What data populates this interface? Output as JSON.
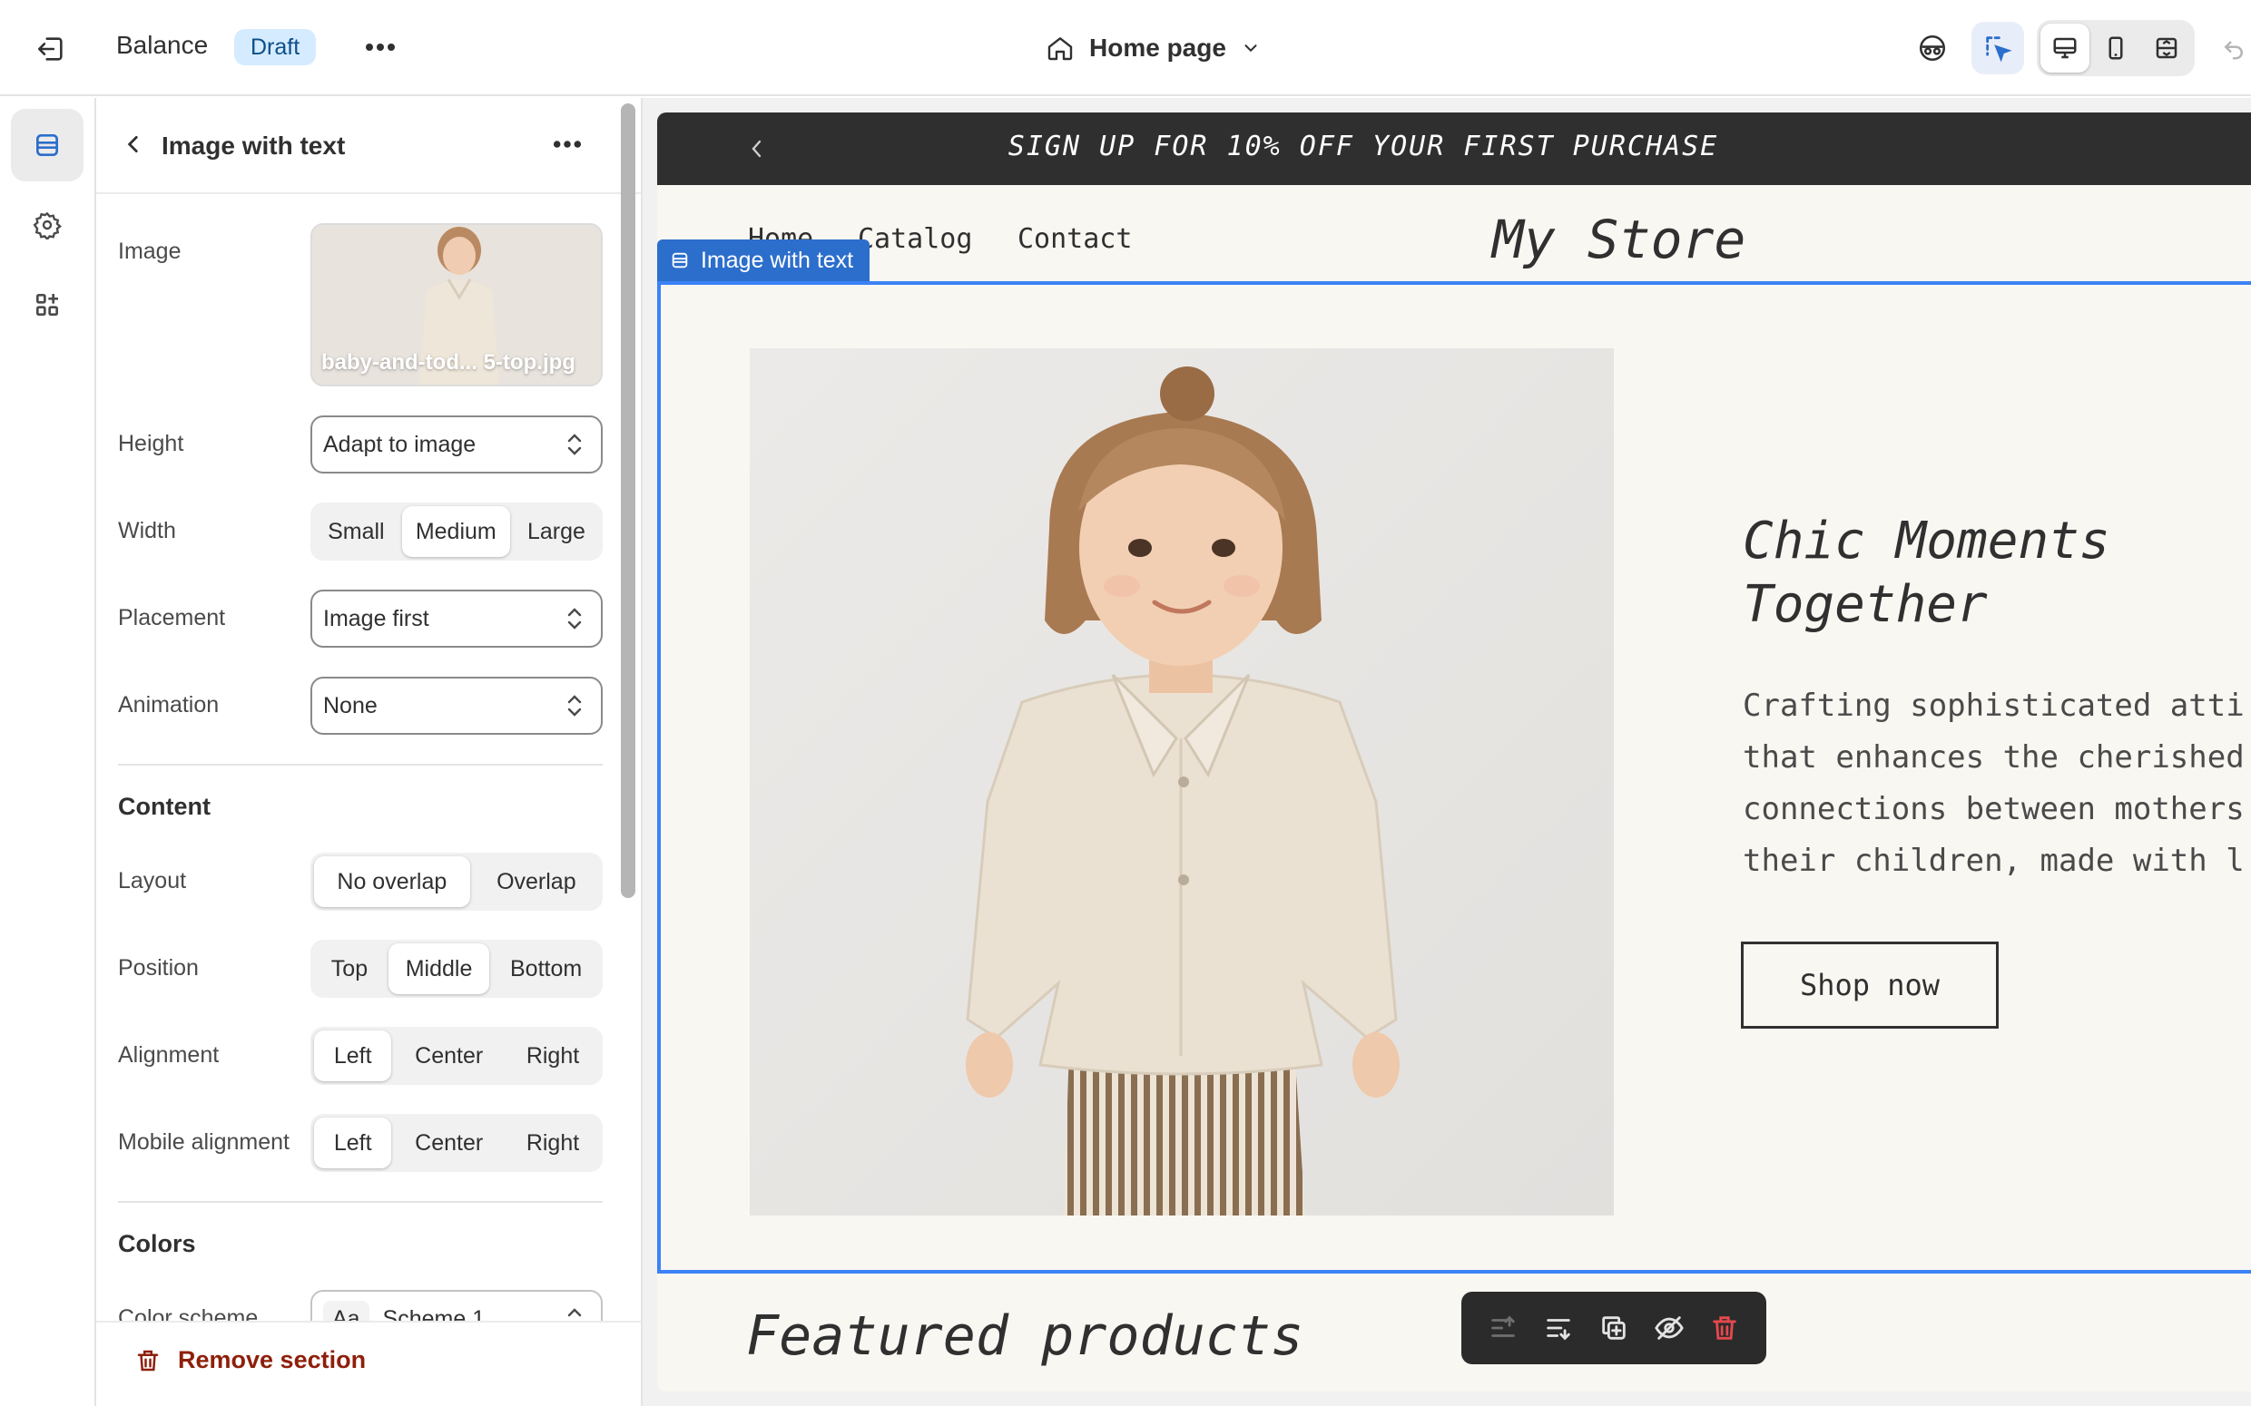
{
  "topbar": {
    "theme_name": "Balance",
    "status_badge": "Draft",
    "page_selector": "Home page"
  },
  "panel": {
    "title": "Image with text",
    "image_label": "Image",
    "image_filename": "baby-and-tod... 5-top.jpg",
    "height_label": "Height",
    "height_value": "Adapt to image",
    "width_label": "Width",
    "width_options": [
      "Small",
      "Medium",
      "Large"
    ],
    "width_selected": "Medium",
    "placement_label": "Placement",
    "placement_value": "Image first",
    "animation_label": "Animation",
    "animation_value": "None",
    "content_heading": "Content",
    "layout_label": "Layout",
    "layout_options": [
      "No overlap",
      "Overlap"
    ],
    "layout_selected": "No overlap",
    "position_label": "Position",
    "position_options": [
      "Top",
      "Middle",
      "Bottom"
    ],
    "position_selected": "Middle",
    "alignment_label": "Alignment",
    "alignment_options": [
      "Left",
      "Center",
      "Right"
    ],
    "alignment_selected": "Left",
    "mobile_alignment_label": "Mobile alignment",
    "mobile_alignment_options": [
      "Left",
      "Center",
      "Right"
    ],
    "mobile_alignment_selected": "Left",
    "colors_heading": "Colors",
    "color_scheme_label": "Color scheme",
    "color_scheme_swatch": "Aa",
    "color_scheme_value": "Scheme 1",
    "remove_label": "Remove section"
  },
  "store": {
    "announcement": "SIGN UP FOR 10% OFF YOUR FIRST PURCHASE",
    "nav": [
      "Home",
      "Catalog",
      "Contact"
    ],
    "brand": "My Store",
    "selected_section_tag": "Image with text",
    "hero_heading_line1": "Chic Moments",
    "hero_heading_line2": "Together",
    "hero_body": [
      "Crafting sophisticated atti",
      "that enhances the cherished",
      "connections between mothers",
      "their children, made with l"
    ],
    "hero_button": "Shop now",
    "featured_heading": "Featured products"
  },
  "colors": {
    "accent_blue": "#2c6ecb",
    "draft_badge_bg": "#d5ebff",
    "announcement_bg": "#2f2f2f",
    "store_bg": "#f9f7f2",
    "danger": "#8e1f0b",
    "delete_icon": "#e5484d"
  }
}
